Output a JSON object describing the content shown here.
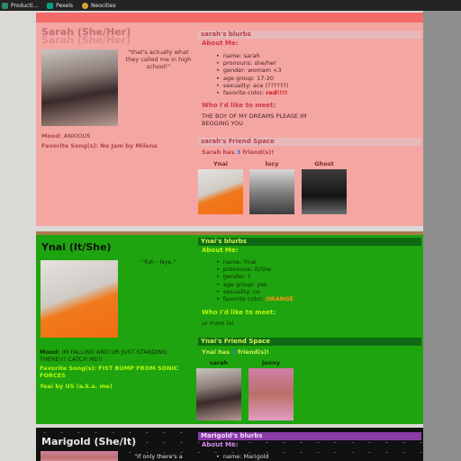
{
  "browser": {
    "bookmarks": [
      {
        "label": "Producti...",
        "icon": "extension-icon"
      },
      {
        "label": "Pexels",
        "icon": "pexels-icon"
      },
      {
        "label": "Neocities",
        "icon": "neocities-icon"
      }
    ]
  },
  "profiles": {
    "sarah": {
      "name": "Sarah (She/Her)",
      "quote": "\"that's actually what they called me in high school!\"",
      "mood_label": "Mood:",
      "mood": "ANXIOUS",
      "fav_label": "Favorite Song(s):",
      "fav": "No Jam by Milena",
      "blurbs_title": "sarah's blurbs",
      "about_title": "About Me:",
      "facts": [
        "name: sarah",
        "pronouns: she/her",
        "gender: womam <3",
        "age group: 17-20",
        "sexuality: ace (??????)"
      ],
      "fav_color_label": "favorite color:",
      "fav_color": "red!!!!",
      "meet_title": "Who I'd like to meet:",
      "meet_text": "THE BOY OF MY DREAMS PLEASE IM BEGGING YOU",
      "friends_title": "sarah's Friend Space",
      "friends_count_pre": "Sarah has",
      "friends_count": "3",
      "friends_count_post": "friend(s)!",
      "friends": [
        "Ynai",
        "lucy",
        "Ghost"
      ]
    },
    "ynai": {
      "name": "Ynai (It/She)",
      "quote": "\"Yuh - Nye.\"",
      "mood_label": "Mood:",
      "mood": "IM FALLING AND UR JUST STANDING THERE!!! CATCH ME!!",
      "fav_label": "Favorite Song(s):",
      "fav": "FIST BUMP FROM SONIC FORCES",
      "fav2": "Yeai by US (a.k.a. me)",
      "blurbs_title": "Ynai's blurbs",
      "about_title": "About Me:",
      "facts": [
        "name: Ynai",
        "pronouns: it/She",
        "gender: ?",
        "age group: yes",
        "sexuality: no"
      ],
      "fav_color_label": "favorite color:",
      "fav_color": "ORANGE",
      "meet_title": "Who I'd like to meet:",
      "meet_text": "ur mom lol",
      "friends_title": "Ynai's Friend Space",
      "friends_count_pre": "Ynai has",
      "friends_count": "2",
      "friends_count_post": "friend(s)!",
      "friends": [
        "sarah",
        "jenny"
      ]
    },
    "marigold": {
      "name": "Marigold (She/It)",
      "quote": "\"if only there's a",
      "blurbs_title": "Marigold's blurbs",
      "about_title": "About Me:",
      "facts": [
        "name: Marigold"
      ]
    }
  }
}
